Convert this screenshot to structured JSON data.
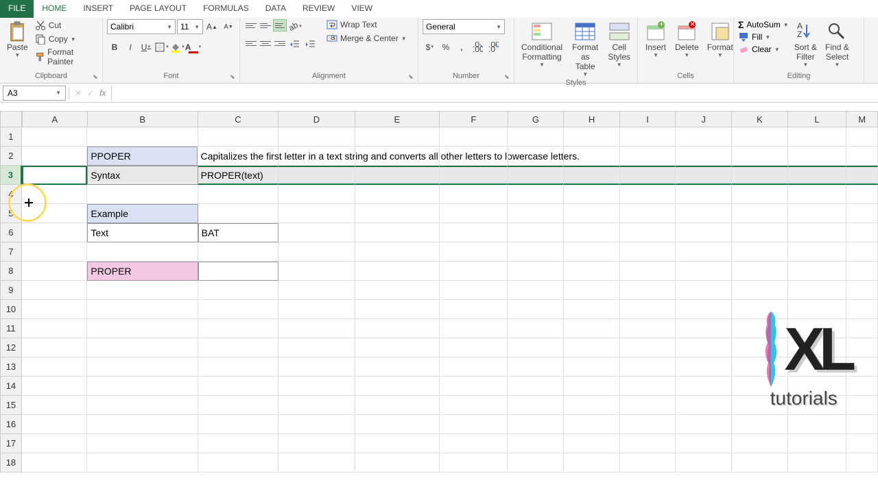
{
  "tabs": {
    "file": "FILE",
    "home": "HOME",
    "insert": "INSERT",
    "page_layout": "PAGE LAYOUT",
    "formulas": "FORMULAS",
    "data": "DATA",
    "review": "REVIEW",
    "view": "VIEW"
  },
  "clipboard": {
    "label": "Clipboard",
    "paste": "Paste",
    "cut": "Cut",
    "copy": "Copy",
    "format_painter": "Format Painter"
  },
  "font": {
    "label": "Font",
    "name": "Calibri",
    "size": "11"
  },
  "alignment": {
    "label": "Alignment",
    "wrap": "Wrap Text",
    "merge": "Merge & Center"
  },
  "number": {
    "label": "Number",
    "format": "General"
  },
  "styles": {
    "label": "Styles",
    "conditional": "Conditional\nFormatting",
    "table": "Format as\nTable",
    "cell": "Cell\nStyles"
  },
  "cells": {
    "label": "Cells",
    "insert": "Insert",
    "delete": "Delete",
    "format": "Format"
  },
  "editing": {
    "label": "Editing",
    "autosum": "AutoSum",
    "fill": "Fill",
    "clear": "Clear",
    "sort": "Sort &\nFilter",
    "find": "Find &\nSelect"
  },
  "name_box": "A3",
  "columns": [
    "A",
    "B",
    "C",
    "D",
    "E",
    "F",
    "G",
    "H",
    "I",
    "J",
    "K",
    "L",
    "M"
  ],
  "sheet": {
    "b2": "PPOPER",
    "c2": "Capitalizes the first letter in a text string and converts all other letters to lowercase letters.",
    "b3": "Syntax",
    "c3": "PROPER(text)",
    "b5": "Example",
    "b6": "Text",
    "c6": "BAT",
    "b8": "PROPER"
  },
  "logo": {
    "main": "XL",
    "sub": "tutorials"
  }
}
